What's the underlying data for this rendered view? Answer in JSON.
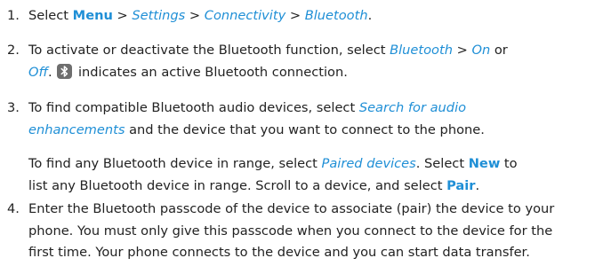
{
  "steps": [
    {
      "number": "1.",
      "lines": [
        [
          {
            "t": "plain",
            "v": "Select "
          },
          {
            "t": "menu",
            "v": "Menu"
          },
          {
            "t": "plain",
            "v": " > "
          },
          {
            "t": "ital",
            "v": "Settings"
          },
          {
            "t": "plain",
            "v": " > "
          },
          {
            "t": "ital",
            "v": "Connectivity"
          },
          {
            "t": "plain",
            "v": " > "
          },
          {
            "t": "ital",
            "v": "Bluetooth"
          },
          {
            "t": "plain",
            "v": "."
          }
        ]
      ]
    },
    {
      "number": "2.",
      "lines": [
        [
          {
            "t": "plain",
            "v": "To activate or deactivate the Bluetooth function, select "
          },
          {
            "t": "ital",
            "v": "Bluetooth"
          },
          {
            "t": "plain",
            "v": " > "
          },
          {
            "t": "ital",
            "v": "On"
          },
          {
            "t": "plain",
            "v": " or"
          }
        ],
        [
          {
            "t": "ital",
            "v": "Off"
          },
          {
            "t": "plain",
            "v": ". "
          },
          {
            "t": "icon",
            "v": "bluetooth-icon"
          },
          {
            "t": "plain",
            "v": " indicates an active Bluetooth connection."
          }
        ]
      ]
    },
    {
      "number": "3.",
      "lines": [
        [
          {
            "t": "plain",
            "v": "To find compatible Bluetooth audio devices, select "
          },
          {
            "t": "ital",
            "v": "Search for audio"
          }
        ],
        [
          {
            "t": "ital",
            "v": "enhancements"
          },
          {
            "t": "plain",
            "v": " and the device that you want to connect to the phone."
          }
        ]
      ],
      "para2": [
        [
          {
            "t": "plain",
            "v": "To find any Bluetooth device in range, select "
          },
          {
            "t": "ital",
            "v": "Paired devices"
          },
          {
            "t": "plain",
            "v": ". Select "
          },
          {
            "t": "menu",
            "v": "New"
          },
          {
            "t": "plain",
            "v": " to"
          }
        ],
        [
          {
            "t": "plain",
            "v": "list any Bluetooth device in range. Scroll to a device, and select "
          },
          {
            "t": "menu",
            "v": "Pair"
          },
          {
            "t": "plain",
            "v": "."
          }
        ]
      ]
    },
    {
      "number": "4.",
      "lines": [
        [
          {
            "t": "plain",
            "v": "Enter the Bluetooth passcode of the device to associate (pair) the device to your"
          }
        ],
        [
          {
            "t": "plain",
            "v": "phone. You must only give this passcode when you connect to the device for the"
          }
        ],
        [
          {
            "t": "plain",
            "v": "first time. Your phone connects to the device and you can start data transfer."
          }
        ]
      ]
    }
  ],
  "colors": {
    "accent": "#1f8fd6",
    "text": "#222222",
    "icon_bg": "#6e6e6e"
  }
}
